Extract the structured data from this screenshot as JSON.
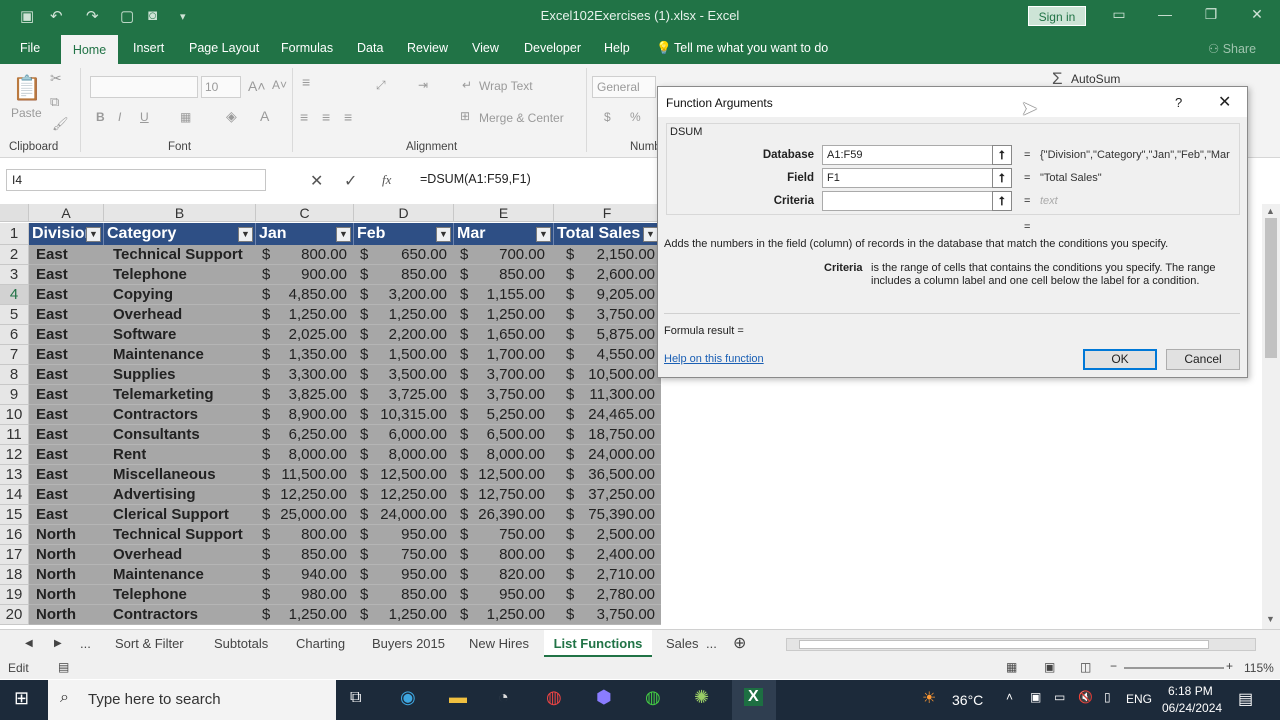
{
  "window": {
    "title": "Excel102Exercises (1).xlsx - Excel",
    "signin": "Sign in"
  },
  "ribbon_tabs": [
    "File",
    "Home",
    "Insert",
    "Page Layout",
    "Formulas",
    "Data",
    "Review",
    "View",
    "Developer",
    "Help"
  ],
  "tell_me": "Tell me what you want to do",
  "share": "Share",
  "ribbon": {
    "paste": "Paste",
    "font_size": "10",
    "wrap_text": "Wrap Text",
    "merge_center": "Merge & Center",
    "number_format": "General",
    "autosum": "AutoSum",
    "groups": {
      "clipboard": "Clipboard",
      "font": "Font",
      "alignment": "Alignment",
      "number": "Numb"
    }
  },
  "formula_bar": {
    "name_box": "I4",
    "formula": "=DSUM(A1:F59,F1)",
    "fx": "fx"
  },
  "columns": [
    "A",
    "B",
    "C",
    "D",
    "E",
    "F"
  ],
  "headers": [
    "Division",
    "Category",
    "Jan",
    "Feb",
    "Mar",
    "Total Sales"
  ],
  "rows": [
    {
      "n": "2",
      "div": "East",
      "cat": "Technical Support",
      "jan": "800.00",
      "feb": "650.00",
      "mar": "700.00",
      "tot": "2,150.00"
    },
    {
      "n": "3",
      "div": "East",
      "cat": "Telephone",
      "jan": "900.00",
      "feb": "850.00",
      "mar": "850.00",
      "tot": "2,600.00"
    },
    {
      "n": "4",
      "div": "East",
      "cat": "Copying",
      "jan": "4,850.00",
      "feb": "3,200.00",
      "mar": "1,155.00",
      "tot": "9,205.00"
    },
    {
      "n": "5",
      "div": "East",
      "cat": "Overhead",
      "jan": "1,250.00",
      "feb": "1,250.00",
      "mar": "1,250.00",
      "tot": "3,750.00"
    },
    {
      "n": "6",
      "div": "East",
      "cat": "Software",
      "jan": "2,025.00",
      "feb": "2,200.00",
      "mar": "1,650.00",
      "tot": "5,875.00"
    },
    {
      "n": "7",
      "div": "East",
      "cat": "Maintenance",
      "jan": "1,350.00",
      "feb": "1,500.00",
      "mar": "1,700.00",
      "tot": "4,550.00"
    },
    {
      "n": "8",
      "div": "East",
      "cat": "Supplies",
      "jan": "3,300.00",
      "feb": "3,500.00",
      "mar": "3,700.00",
      "tot": "10,500.00"
    },
    {
      "n": "9",
      "div": "East",
      "cat": "Telemarketing",
      "jan": "3,825.00",
      "feb": "3,725.00",
      "mar": "3,750.00",
      "tot": "11,300.00"
    },
    {
      "n": "10",
      "div": "East",
      "cat": "Contractors",
      "jan": "8,900.00",
      "feb": "10,315.00",
      "mar": "5,250.00",
      "tot": "24,465.00"
    },
    {
      "n": "11",
      "div": "East",
      "cat": "Consultants",
      "jan": "6,250.00",
      "feb": "6,000.00",
      "mar": "6,500.00",
      "tot": "18,750.00"
    },
    {
      "n": "12",
      "div": "East",
      "cat": "Rent",
      "jan": "8,000.00",
      "feb": "8,000.00",
      "mar": "8,000.00",
      "tot": "24,000.00"
    },
    {
      "n": "13",
      "div": "East",
      "cat": "Miscellaneous",
      "jan": "11,500.00",
      "feb": "12,500.00",
      "mar": "12,500.00",
      "tot": "36,500.00"
    },
    {
      "n": "14",
      "div": "East",
      "cat": "Advertising",
      "jan": "12,250.00",
      "feb": "12,250.00",
      "mar": "12,750.00",
      "tot": "37,250.00"
    },
    {
      "n": "15",
      "div": "East",
      "cat": "Clerical Support",
      "jan": "25,000.00",
      "feb": "24,000.00",
      "mar": "26,390.00",
      "tot": "75,390.00"
    },
    {
      "n": "16",
      "div": "North",
      "cat": "Technical Support",
      "jan": "800.00",
      "feb": "950.00",
      "mar": "750.00",
      "tot": "2,500.00"
    },
    {
      "n": "17",
      "div": "North",
      "cat": "Overhead",
      "jan": "850.00",
      "feb": "750.00",
      "mar": "800.00",
      "tot": "2,400.00"
    },
    {
      "n": "18",
      "div": "North",
      "cat": "Maintenance",
      "jan": "940.00",
      "feb": "950.00",
      "mar": "820.00",
      "tot": "2,710.00"
    },
    {
      "n": "19",
      "div": "North",
      "cat": "Telephone",
      "jan": "980.00",
      "feb": "850.00",
      "mar": "950.00",
      "tot": "2,780.00"
    },
    {
      "n": "20",
      "div": "North",
      "cat": "Contractors",
      "jan": "1,250.00",
      "feb": "1,250.00",
      "mar": "1,250.00",
      "tot": "3,750.00"
    }
  ],
  "currency": "$",
  "sheet_tabs": [
    "...",
    "Sort & Filter",
    "Subtotals",
    "Charting",
    "Buyers 2015",
    "New Hires",
    "List Functions",
    "Sales",
    "..."
  ],
  "active_sheet": "List Functions",
  "status": {
    "mode": "Edit",
    "zoom": "115%"
  },
  "dialog": {
    "title": "Function Arguments",
    "help_glyph": "?",
    "function": "DSUM",
    "args": [
      {
        "label": "Database",
        "value": "A1:F59",
        "result": "{\"Division\",\"Category\",\"Jan\",\"Feb\",\"Mar"
      },
      {
        "label": "Field",
        "value": "F1",
        "result": "\"Total Sales\""
      },
      {
        "label": "Criteria",
        "value": "",
        "result": "text"
      }
    ],
    "eq": "=",
    "description": "Adds the numbers in the field (column) of records in the database that match the conditions you specify.",
    "arg_help_label": "Criteria",
    "arg_help_text": "is the range of cells that contains the conditions you specify. The range includes a column label and one cell below the label for a condition.",
    "formula_result": "Formula result =",
    "help_link": "Help on this function",
    "ok": "OK",
    "cancel": "Cancel"
  },
  "taskbar": {
    "search_placeholder": "Type here to search",
    "temp": "36°C",
    "lang": "ENG",
    "time": "6:18 PM",
    "date": "06/24/2024"
  }
}
